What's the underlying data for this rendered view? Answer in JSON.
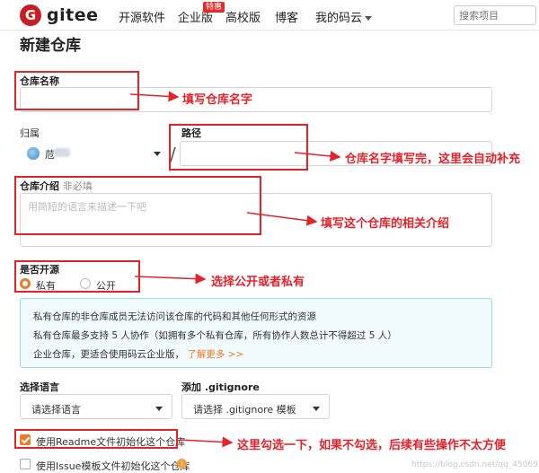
{
  "nav": {
    "logo_letter": "G",
    "logo_text": "gitee",
    "links": [
      "开源软件",
      "企业版",
      "高校版",
      "博客",
      "我的码云"
    ],
    "badge": "特惠",
    "search_placeholder": "搜索项目"
  },
  "page_title": "新建仓库",
  "form": {
    "repo_name_label": "仓库名称",
    "owner_label": "归属",
    "owner_value": "苊",
    "path_label": "路径",
    "path_separator": "/",
    "desc_label": "仓库介绍",
    "desc_optional": "非必填",
    "desc_placeholder": "用简短的语言来描述一下吧",
    "open_label": "是否开源",
    "visibility_options": [
      {
        "label": "私有",
        "selected": true
      },
      {
        "label": "公开",
        "selected": false
      }
    ],
    "info_lines": [
      "私有仓库的非仓库成员无法访问该仓库的代码和其他任何形式的资源",
      "私有仓库最多支持 5 人协作（如拥有多个私有仓库，所有协作人数总计不得超过 5 人）",
      "企业仓库，更适合使用码云企业版，"
    ],
    "info_link": "了解更多 >>",
    "language_label": "选择语言",
    "language_value": "请选择语言",
    "gitignore_label": "添加 .gitignore",
    "gitignore_value": "请选择 .gitignore 模板",
    "readme_checkbox": {
      "label": "使用Readme文件初始化这个仓库",
      "checked": true
    },
    "issue_checkbox": {
      "label": "使用Issue模板文件初始化这个仓库",
      "checked": false
    }
  },
  "annotations": {
    "name": "填写仓库名字",
    "path": "仓库名字填写完，这里会自动补充",
    "desc": "填写这个仓库的相关介绍",
    "open": "选择公开或者私有",
    "readme": "这里勾选一下，如果不勾选，后续有些操作不太方便"
  },
  "watermark": "https://blog.csdn.net/qq_45069279",
  "colors": {
    "brand": "#c71d23",
    "accent": "#f0792a",
    "annotation": "#e3222a"
  }
}
